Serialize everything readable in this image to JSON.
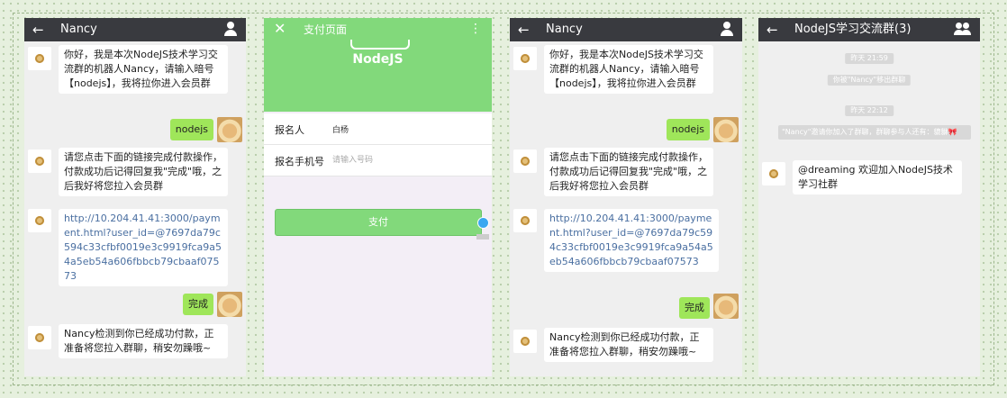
{
  "panel1": {
    "title": "Nancy",
    "messages": {
      "m1": "你好，我是本次NodeJS技术学习交流群的机器人Nancy，请输入暗号【nodejs】，我将拉你进入会员群",
      "m2": "nodejs",
      "m3": "请您点击下面的链接完成付款操作，付款成功后记得回复我\"完成\"哦，之后我好将您拉入会员群",
      "m4": "http://10.204.41.41:3000/payment.html?user_id=@7697da79c594c33cfbf0019e3c9919fca9a54a5eb54a606fbbcb79cbaaf07573",
      "m5": "完成",
      "m6": "Nancy检测到你已经成功付款，正准备将您拉入群聊，稍安勿躁哦~"
    }
  },
  "panel2": {
    "title": "支付页面",
    "logo_text": "NodeJS",
    "name_label": "报名人",
    "name_value": "白杨",
    "phone_label": "报名手机号",
    "phone_placeholder": "请输入号码",
    "pay_button": "支付"
  },
  "panel3": {
    "title": "Nancy",
    "messages": {
      "m1": "你好，我是本次NodeJS技术学习交流群的机器人Nancy，请输入暗号【nodejs】，我将拉你进入会员群",
      "m2": "nodejs",
      "m3": "请您点击下面的链接完成付款操作，付款成功后记得回复我\"完成\"哦，之后我好将您拉入会员群",
      "m4": "http://10.204.41.41:3000/payment.html?user_id=@7697da79c594c33cfbf0019e3c9919fca9a54a5eb54a606fbbcb79cbaaf07573",
      "m5": "完成",
      "m6": "Nancy检测到你已经成功付款，正准备将您拉入群聊，稍安勿躁哦~"
    }
  },
  "panel4": {
    "title": "NodeJS学习交流群(3)",
    "time1": "昨天 21:59",
    "notice1": "你被\"Nancy\"移出群聊",
    "time2": "昨天 22:12",
    "notice2": "\"Nancy\"邀请你加入了群聊，群聊参与人还有：貔貅",
    "welcome": "@dreaming 欢迎加入NodeJS技术学习社群"
  },
  "colors": {
    "topbar": "#393a3f",
    "bubble_self": "#9fe65a",
    "link": "#4a6fa1",
    "pay_green": "#82d97b"
  }
}
